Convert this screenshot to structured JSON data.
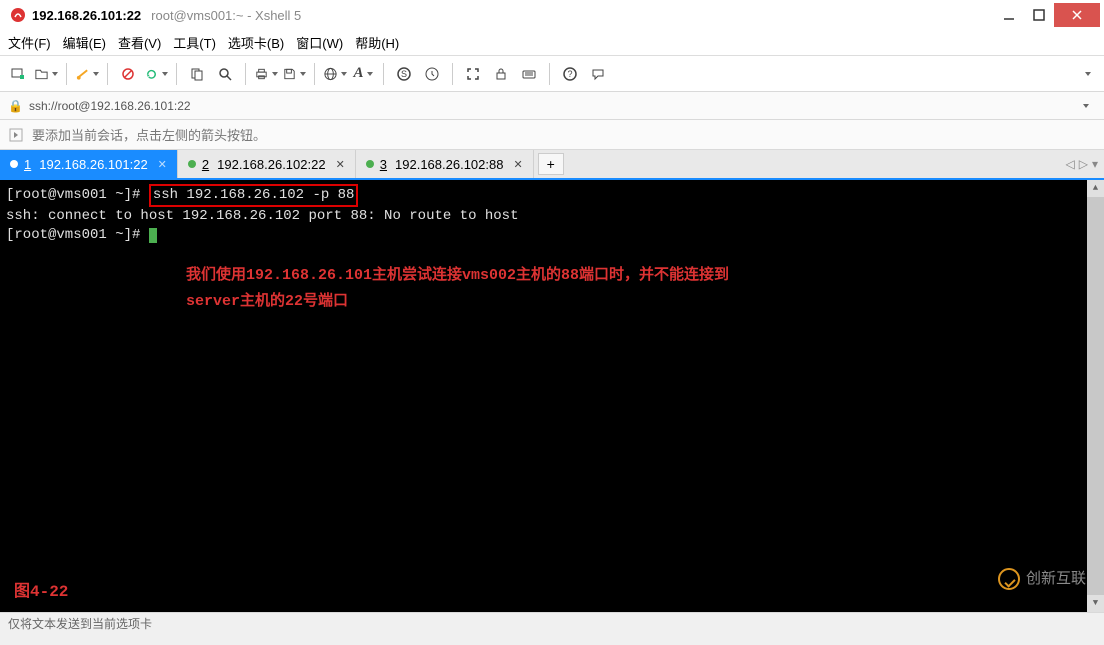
{
  "window": {
    "title_main": "192.168.26.101:22",
    "title_sub": "root@vms001:~ - Xshell 5"
  },
  "menu": {
    "file": "文件(F)",
    "edit": "编辑(E)",
    "view": "查看(V)",
    "tools": "工具(T)",
    "tabs": "选项卡(B)",
    "window": "窗口(W)",
    "help": "帮助(H)"
  },
  "toolbar_icons": {
    "new_session": "new-session-icon",
    "open": "open-icon",
    "connect": "connect-icon",
    "disconnect": "disconnect-icon",
    "copy": "copy-icon",
    "paste": "paste-icon",
    "find": "find-icon",
    "print": "print-icon",
    "save": "save-icon",
    "web": "web-icon",
    "font": "font-icon",
    "s_script": "s-script-icon",
    "history": "history-icon",
    "fullscreen": "fullscreen-icon",
    "lock": "lock-icon",
    "keyboard": "keyboard-icon",
    "help": "help-icon",
    "chat": "chat-icon"
  },
  "address": {
    "url": "ssh://root@192.168.26.101:22"
  },
  "infobar": {
    "hint": "要添加当前会话，点击左侧的箭头按钮。"
  },
  "tabs": [
    {
      "num": "1",
      "label": "192.168.26.101:22",
      "active": true
    },
    {
      "num": "2",
      "label": "192.168.26.102:22",
      "active": false
    },
    {
      "num": "3",
      "label": "192.168.26.102:88",
      "active": false
    }
  ],
  "terminal": {
    "prompt1": "[root@vms001 ~]#",
    "command": "ssh 192.168.26.102 -p 88",
    "output1": "ssh: connect to host 192.168.26.102 port 88: No route to host",
    "prompt2": "[root@vms001 ~]# ",
    "note_line1": "我们使用192.168.26.101主机尝试连接vms002主机的88端口时，并不能连接到",
    "note_line2": "server主机的22号端口",
    "figure_label": "图4-22"
  },
  "statusbar": {
    "text": "仅将文本发送到当前选项卡"
  },
  "watermark": {
    "text": "创新互联"
  }
}
